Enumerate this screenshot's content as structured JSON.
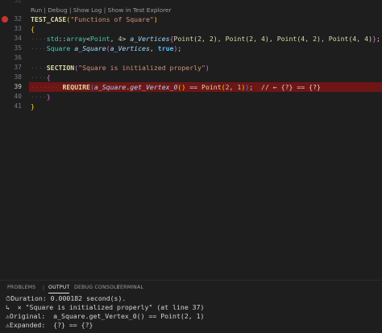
{
  "editor": {
    "line_numbers": [
      "32",
      "32",
      "33",
      "34",
      "35",
      "36",
      "37",
      "38",
      "39",
      "40",
      "41"
    ],
    "codelens": "Run | Debug | Show Log | Show in Test Explorer",
    "tokens": {
      "test_case": "TEST_CASE",
      "test_name": "\"Functions of Square\"",
      "std": "std",
      "array": "array",
      "point": "Point",
      "four": "4",
      "a_vertices": "a_Vertices",
      "p1": "Point(2, 2)",
      "p2": "Point(2, 4)",
      "p3": "Point(4, 2)",
      "p4": "Point(4, 4)",
      "square": "Square",
      "a_square": "a_Square",
      "true_kw": "true",
      "section": "SECTION",
      "section_name": "\"Square is initialized properly\"",
      "require": "REQUIRE",
      "get_vertex": "get_Vertex_0",
      "point_fn": "Point",
      "two": "2",
      "one": "1",
      "inline_msg": "// ← {?} == {?}"
    }
  },
  "panel": {
    "tabs": [
      "PROBLEMS",
      "OUTPUT",
      "DEBUG CONSOLE",
      "TERMINAL"
    ],
    "active_tab": "OUTPUT",
    "output_lines": [
      "⏱Duration: 0.000182 second(s).",
      "↳  ✕ \"Square is initialized properly\" (at line 37)",
      "⚠Original:  a_Square.get_Vertex_0() == Point(2, 1)",
      "⚠Expanded:  {?} == {?}"
    ]
  },
  "colors": {
    "background": "#1e1e1e",
    "error_line": "#6e1515",
    "breakpoint": "#c5362f",
    "keyword": "#4fc1ff",
    "string": "#ce9178",
    "type": "#4ec9b0",
    "variable": "#9cdcfe"
  }
}
